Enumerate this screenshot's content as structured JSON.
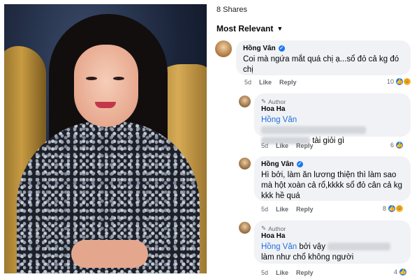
{
  "header": {
    "shares": "8 Shares",
    "sort_label": "Most Relevant"
  },
  "icons": {
    "sort": "chevron-down-icon",
    "verified": "verified-badge-icon",
    "author": "pencil-icon",
    "reactions": [
      "like-reaction-icon",
      "haha-reaction-icon"
    ]
  },
  "colors": {
    "bubble": "#f0f2f5",
    "mention": "#216fdb",
    "meta": "#65676b",
    "like": "#1877f2"
  },
  "comments": [
    {
      "name": "Hồng Vân",
      "verified": true,
      "text": "Coi mà ngứa mắt quá chị ạ...sổ đỏ cả kg đó chị",
      "time": "5d",
      "like": "Like",
      "reply": "Reply",
      "reaction_count": "10"
    },
    {
      "author_badge": "Author",
      "name": "Hoa Ha",
      "mention": "Hồng Vân",
      "text_tail": "tài giỏi gì",
      "time": "5d",
      "like": "Like",
      "reply": "Reply",
      "reaction_count": "6"
    },
    {
      "name": "Hồng Vân",
      "verified": true,
      "text": "Hì bởi, làm ăn lương thiện thì làm sao mà hột xoàn cả rổ,kkkk sổ đỏ cân cả kg kkk hề quá",
      "time": "5d",
      "like": "Like",
      "reply": "Reply",
      "reaction_count": "8"
    },
    {
      "author_badge": "Author",
      "name": "Hoa Ha",
      "mention": "Hồng Vân",
      "text_mid": "bởi vậy",
      "text_tail": "làm như chổ không người",
      "time": "5d",
      "like": "Like",
      "reply": "Reply",
      "reaction_count": "4"
    }
  ]
}
